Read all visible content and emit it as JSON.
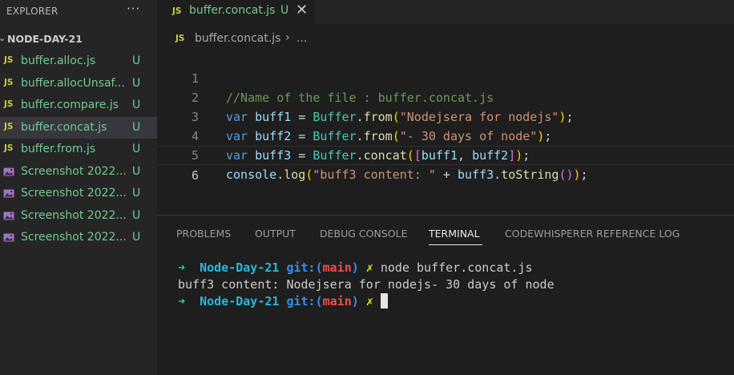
{
  "sidebar": {
    "title": "EXPLORER",
    "more": "···",
    "folder": "NODE-DAY-21",
    "files": [
      {
        "icon": "js",
        "name": "buffer.alloc.js",
        "badge": "U"
      },
      {
        "icon": "js",
        "name": "buffer.allocUnsaf...",
        "badge": "U"
      },
      {
        "icon": "js",
        "name": "buffer.compare.js",
        "badge": "U"
      },
      {
        "icon": "js",
        "name": "buffer.concat.js",
        "badge": "U"
      },
      {
        "icon": "js",
        "name": "buffer.from.js",
        "badge": "U"
      },
      {
        "icon": "image",
        "name": "Screenshot 2022...",
        "badge": "U"
      },
      {
        "icon": "image",
        "name": "Screenshot 2022...",
        "badge": "U"
      },
      {
        "icon": "image",
        "name": "Screenshot 2022...",
        "badge": "U"
      },
      {
        "icon": "image",
        "name": "Screenshot 2022...",
        "badge": "U"
      }
    ]
  },
  "tab": {
    "icon_label": "JS",
    "name": "buffer.concat.js",
    "badge": "U",
    "close": "✕"
  },
  "breadcrumb": {
    "icon_label": "JS",
    "file": "buffer.concat.js",
    "sep": "›",
    "more": "..."
  },
  "editor": {
    "line_numbers": [
      "1",
      "2",
      "3",
      "4",
      "5",
      "6"
    ],
    "line1": {
      "comment": "//Name of the file : buffer.concat.js"
    },
    "line2": {
      "kw": "var",
      "name": "buff1",
      "eq": " = ",
      "obj": "Buffer",
      "dot": ".",
      "fn": "from",
      "open": "(",
      "str": "\"Nodejsera for nodejs\"",
      "close": ")",
      "semi": ";"
    },
    "line3": {
      "kw": "var",
      "name": "buff2",
      "eq": " = ",
      "obj": "Buffer",
      "dot": ".",
      "fn": "from",
      "open": "(",
      "str": "\"- 30 days of node\"",
      "close": ")",
      "semi": ";"
    },
    "line4": {
      "kw": "var",
      "name": "buff3",
      "eq": " = ",
      "obj": "Buffer",
      "dot": ".",
      "fn": "concat",
      "open": "(",
      "sq_open": "[",
      "a": "buff1",
      "comma": ", ",
      "b": "buff2",
      "sq_close": "]",
      "close": ")",
      "semi": ";"
    },
    "line5": {
      "obj": "console",
      "dot": ".",
      "fn": "log",
      "open": "(",
      "str": "\"buff3 content: \"",
      "plus": " + ",
      "var": "buff3",
      "dot2": ".",
      "fn2": "toString",
      "inner": "()",
      "close": ")",
      "semi": ";"
    }
  },
  "panel": {
    "tabs": [
      "PROBLEMS",
      "OUTPUT",
      "DEBUG CONSOLE",
      "TERMINAL",
      "CODEWHISPERER REFERENCE LOG"
    ],
    "active_tab": "TERMINAL"
  },
  "terminal": {
    "arrow": "➜",
    "dir": "Node-Day-21",
    "git": "git:",
    "branch_open": "(",
    "branch": "main",
    "branch_close": ")",
    "dirty": "✗",
    "command": "node buffer.concat.js",
    "output": "buff3 content: Nodejsera for nodejs- 30 days of node"
  },
  "colors": {
    "accent_untracked": "#73c991",
    "js_icon": "#cbcb41",
    "editor_bg": "#1e1e1e",
    "sidebar_bg": "#252526"
  }
}
